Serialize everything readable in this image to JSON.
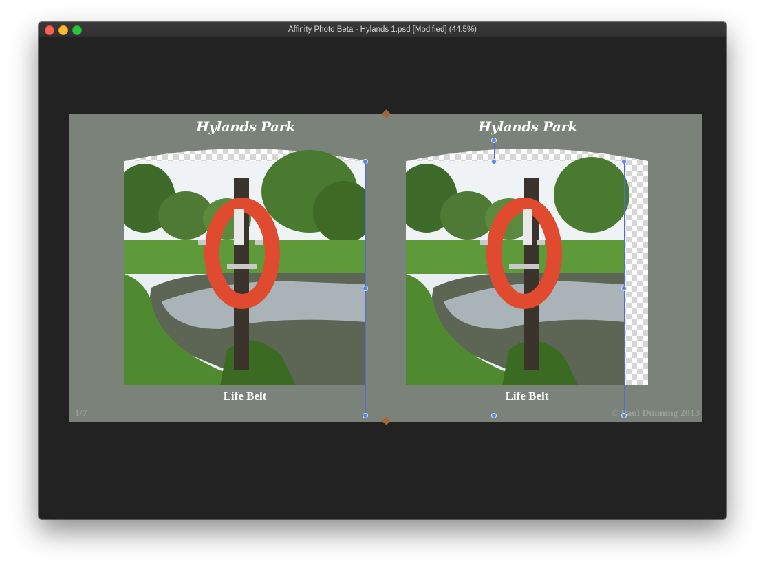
{
  "window": {
    "title": "Affinity Photo Beta - Hylands 1.psd [Modified] (44.5%)",
    "controls": [
      "close-icon",
      "minimize-icon",
      "zoom-icon"
    ]
  },
  "document": {
    "background_color": "#7a8279",
    "left_panel": {
      "title": "Hylands Park",
      "caption": "Life Belt"
    },
    "right_panel": {
      "title": "Hylands Park",
      "caption": "Life Belt"
    },
    "page_number": "1/7",
    "copyright": "© Paul Dunning 2013"
  },
  "selection": {
    "color": "#4a6fd8"
  }
}
